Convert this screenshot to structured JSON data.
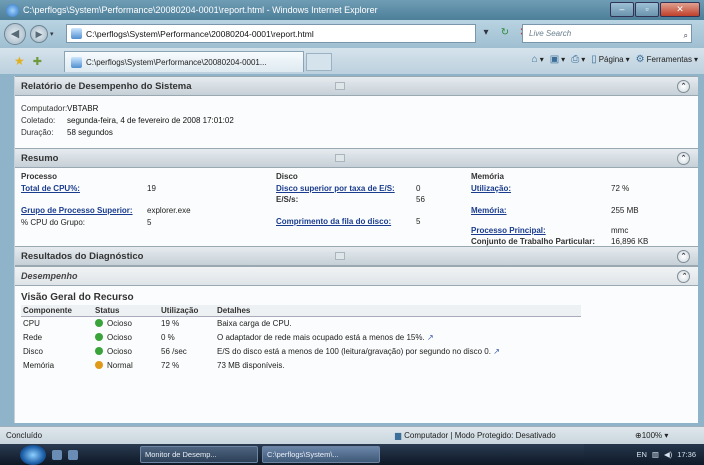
{
  "window": {
    "title": "C:\\perflogs\\System\\Performance\\20080204-0001\\report.html - Windows Internet Explorer",
    "minimize": "–",
    "maximize": "▫",
    "close": "✕"
  },
  "address": {
    "url": "C:\\perflogs\\System\\Performance\\20080204-0001\\report.html",
    "search_placeholder": "Live Search"
  },
  "tabs": [
    {
      "label": "C:\\perflogs\\System\\Performance\\20080204-0001..."
    }
  ],
  "commandbar": {
    "page_label": "Página",
    "tools_label": "Ferramentas"
  },
  "report": {
    "title": "Relatório de Desempenho do Sistema",
    "info": [
      {
        "key": "Computador:",
        "value": "VBTABR"
      },
      {
        "key": "Coletado:",
        "value": "segunda-feira, 4 de fevereiro de 2008 17:01:02"
      },
      {
        "key": "Duração:",
        "value": "58 segundos"
      }
    ]
  },
  "summary": {
    "title": "Resumo",
    "process": {
      "heading": "Processo",
      "total_cpu_label": "Total de CPU%:",
      "total_cpu_value": "19",
      "top_group_label": "Grupo de Processo Superior:",
      "top_group_value": "explorer.exe",
      "group_cpu_label": "% CPU do Grupo:",
      "group_cpu_value": "5"
    },
    "disk": {
      "heading": "Disco",
      "top_disk_label": "Disco superior por taxa de E/S:",
      "top_disk_value": "0",
      "io_label": "E/S/s:",
      "io_value": "56",
      "queue_label": "Comprimento da fila do disco:",
      "queue_value": "5"
    },
    "memory": {
      "heading": "Memória",
      "util_label": "Utilização:",
      "util_value": "72 %",
      "mem_label": "Memória:",
      "mem_value": "255 MB",
      "main_proc_label": "Processo Principal:",
      "main_proc_value": "mmc",
      "working_set_label": "Conjunto de Trabalho Particular:",
      "working_set_value": "16,896 KB"
    }
  },
  "diagnostics": {
    "title": "Resultados do Diagnóstico",
    "subsection": "Desempenho",
    "resource_title": "Visão Geral do Recurso",
    "columns": [
      "Componente",
      "Status",
      "Utilização",
      "Detalhes"
    ],
    "rows": [
      {
        "component": "CPU",
        "status": "Ocioso",
        "status_color": "#3aa33a",
        "util": "19 %",
        "details": "Baixa carga de CPU."
      },
      {
        "component": "Rede",
        "status": "Ocioso",
        "status_color": "#3aa33a",
        "util": "0 %",
        "details": "O adaptador de rede mais ocupado está a menos de 15%."
      },
      {
        "component": "Disco",
        "status": "Ocioso",
        "status_color": "#3aa33a",
        "util": "56 /sec",
        "details": "E/S do disco está a menos de 100 (leitura/gravação) por segundo no disco 0."
      },
      {
        "component": "Memória",
        "status": "Normal",
        "status_color": "#e09a1a",
        "util": "72 %",
        "details": "73 MB disponíveis."
      }
    ]
  },
  "statusbar": {
    "status": "Concluído",
    "zone": "Computador | Modo Protegido: Desativado",
    "zoom": "100%"
  },
  "taskbar": {
    "items": [
      "Monitor de Desemp...",
      "C:\\perflogs\\System\\..."
    ],
    "lang": "EN",
    "clock": "17:36"
  }
}
